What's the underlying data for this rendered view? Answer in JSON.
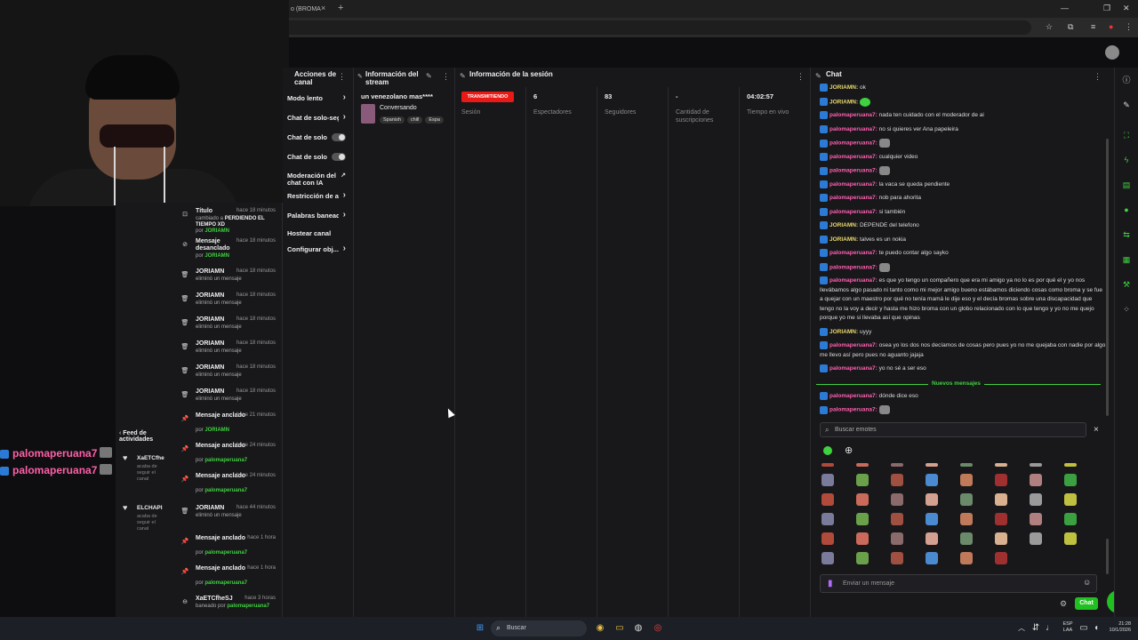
{
  "browser": {
    "tab_title": "o (BROMA",
    "tab_close": "×",
    "new_tab": "+",
    "window_controls": [
      "—",
      "❐",
      "✕"
    ]
  },
  "overlay": {
    "chat_names": [
      "palomaperuana7 :",
      "palomaperuana7 :"
    ]
  },
  "actions_panel": {
    "title": "Acciones de canal",
    "items": [
      {
        "label": "Modo lento",
        "kind": "arrow"
      },
      {
        "label": "Chat de solo-seg",
        "kind": "arrow"
      },
      {
        "label": "Chat de solo",
        "kind": "toggle"
      },
      {
        "label": "Chat de solo",
        "kind": "toggle"
      },
      {
        "label": "Moderación del chat con IA",
        "kind": "external"
      },
      {
        "label": "Restricción de ac",
        "kind": "arrow"
      },
      {
        "label": "Palabras banead",
        "kind": "arrow"
      },
      {
        "label": "Hostear canal",
        "kind": "none"
      },
      {
        "label": "Configurar obj...",
        "kind": "arrow"
      }
    ]
  },
  "stream_info": {
    "title": "Información del stream",
    "stream_title": "un venezolano mas****",
    "category": "Conversando",
    "tags": [
      "Spanish",
      "chill",
      "Espa"
    ]
  },
  "session": {
    "title": "Información de la sesión",
    "live_badge": "TRANSMITIENDO",
    "stats": [
      {
        "value": "",
        "label": "Sesión"
      },
      {
        "value": "6",
        "label": "Espectadores"
      },
      {
        "value": "83",
        "label": "Seguidores"
      },
      {
        "value": "-",
        "label": "Cantidad de suscripciones"
      },
      {
        "value": "04:02:57",
        "label": "Tiempo en vivo"
      }
    ]
  },
  "activity_feed": {
    "title": "Feed de actividades",
    "follows": [
      {
        "name": "XaETCfhe",
        "text": "acaba de seguir el canal"
      },
      {
        "name": "ELCHAPI",
        "text": "acaba de seguir el canal"
      }
    ],
    "items": [
      {
        "icon": "title-icon",
        "title": "Título",
        "time": "hace 18 minutos",
        "sub": "cambiado a",
        "sub_bold": "PERDIENDO EL TIEMPO XD",
        "by_pre": "por",
        "by": "JORIAMN"
      },
      {
        "icon": "unpin-icon",
        "title": "Mensaje desanclado",
        "time": "hace 18 minutos",
        "by_pre": "por",
        "by": "JORIAMN"
      },
      {
        "icon": "trash-icon",
        "title": "JORIAMN",
        "time": "hace 18 minutos",
        "sub": "eliminó un mensaje"
      },
      {
        "icon": "trash-icon",
        "title": "JORIAMN",
        "time": "hace 18 minutos",
        "sub": "eliminó un mensaje"
      },
      {
        "icon": "trash-icon",
        "title": "JORIAMN",
        "time": "hace 18 minutos",
        "sub": "eliminó un mensaje"
      },
      {
        "icon": "trash-icon",
        "title": "JORIAMN",
        "time": "hace 18 minutos",
        "sub": "eliminó un mensaje"
      },
      {
        "icon": "trash-icon",
        "title": "JORIAMN",
        "time": "hace 18 minutos",
        "sub": "eliminó un mensaje"
      },
      {
        "icon": "trash-icon",
        "title": "JORIAMN",
        "time": "hace 18 minutos",
        "sub": "eliminó un mensaje"
      },
      {
        "icon": "pin-icon",
        "title": "Mensaje anclado",
        "time": "hace 21 minutos",
        "by_pre": "por",
        "by": "JORIAMN"
      },
      {
        "icon": "pin-icon",
        "title": "Mensaje anclado",
        "time": "hace 24 minutos",
        "by_pre": "por",
        "by": "palomaperuana7"
      },
      {
        "icon": "pin-icon",
        "title": "Mensaje anclado",
        "time": "hace 24 minutos",
        "by_pre": "por",
        "by": "palomaperuana7"
      },
      {
        "icon": "trash-icon",
        "title": "JORIAMN",
        "time": "hace 44 minutos",
        "sub": "eliminó un mensaje"
      },
      {
        "icon": "pin-icon",
        "title": "Mensaje anclado",
        "time": "hace 1 hora",
        "by_pre": "por",
        "by": "palomaperuana7"
      },
      {
        "icon": "pin-icon",
        "title": "Mensaje anclado",
        "time": "hace 1 hora",
        "by_pre": "por",
        "by": "palomaperuana7"
      },
      {
        "icon": "ban-icon",
        "title": "XaETCfheSJ",
        "time": "hace 3 horas",
        "sub": "baneado por",
        "by": "palomaperuana7"
      }
    ]
  },
  "chat": {
    "title": "Chat",
    "messages": [
      {
        "user": "JORIAMN:",
        "role": "mod",
        "text": "ok"
      },
      {
        "user": "JORIAMN:",
        "role": "mod",
        "text": "",
        "emote": "green"
      },
      {
        "user": "palomaperuana7:",
        "role": "user",
        "text": "nada ten cuidado con el moderador de ai"
      },
      {
        "user": "palomaperuana7:",
        "role": "user",
        "text": "no si quieres ver Ana papeleira"
      },
      {
        "user": "palomaperuana7:",
        "role": "user",
        "text": "",
        "emote": "gray"
      },
      {
        "user": "palomaperuana7:",
        "role": "user",
        "text": "cualquier video"
      },
      {
        "user": "palomaperuana7:",
        "role": "user",
        "text": "",
        "emote": "gray"
      },
      {
        "user": "palomaperuana7:",
        "role": "user",
        "text": "la vaca se queda pendiente"
      },
      {
        "user": "palomaperuana7:",
        "role": "user",
        "text": "nob para ahorita"
      },
      {
        "user": "palomaperuana7:",
        "role": "user",
        "text": "si también"
      },
      {
        "user": "JORIAMN:",
        "role": "mod",
        "text": "DEPENDE del telefono"
      },
      {
        "user": "JORIAMN:",
        "role": "mod",
        "text": "talves es un nokia"
      },
      {
        "user": "palomaperuana7:",
        "role": "user",
        "text": "te puedo contar algo sayko"
      },
      {
        "user": "palomaperuana7:",
        "role": "user",
        "text": "",
        "emote": "gray"
      },
      {
        "user": "palomaperuana7:",
        "role": "user",
        "text": "es que yo tengo un compañero que era mi amigo ya no lo es por qué el y yo nos llevábamos algo pasado ni tanto como mi mejor amigo bueno estábamos diciendo cosas como broma y se fue a quejar con un maestro por qué no tenía mamá le dije eso y el decía bromas sobre una discapacidad que tengo no la voy a decir y hasta me hizo broma con un globo relacionado con lo que tengo y yo no me quejo porque yo me si llevaba así que opinas",
        "lines": 5
      },
      {
        "user": "JORIAMN:",
        "role": "mod",
        "text": "uyyy"
      },
      {
        "user": "palomaperuana7:",
        "role": "user",
        "text": "osea yo los dos nos decíamos de cosas pero pues yo no me quejaba con nadie por algo me llevo así pero pues no aguanto jajaja",
        "lines": 2
      },
      {
        "user": "palomaperuana7:",
        "role": "user",
        "text": "yo no sé a ser eso"
      }
    ],
    "new_messages_label": "Nuevos mensajes",
    "after_messages": [
      {
        "user": "palomaperuana7:",
        "role": "user",
        "text": "dónde dice eso"
      },
      {
        "user": "palomaperuana7:",
        "role": "user",
        "text": "",
        "emote": "gray"
      }
    ],
    "emote_search_placeholder": "Buscar emotes",
    "message_placeholder": "Enviar un mensaje",
    "send_label": "Chat"
  },
  "taskbar": {
    "search_label": "Buscar",
    "lang": "ESP",
    "lang2": "LAA",
    "time": "21:28",
    "date": "10/1/2026"
  }
}
